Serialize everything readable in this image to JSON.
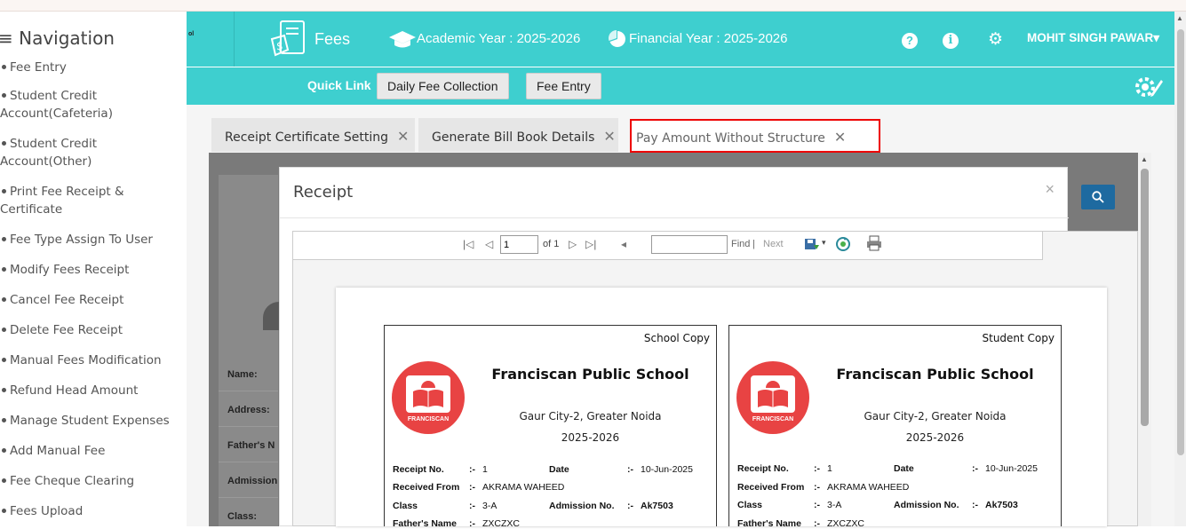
{
  "sidebar": {
    "title": "≡ Navigation",
    "items": [
      {
        "label": "Fee Entry"
      },
      {
        "label": "Student Credit Account(Cafeteria)"
      },
      {
        "label": "Student Credit Account(Other)"
      },
      {
        "label": "Print Fee Receipt & Certificate"
      },
      {
        "label": "Fee Type Assign To User"
      },
      {
        "label": "Modify Fees Receipt"
      },
      {
        "label": "Cancel Fee Receipt"
      },
      {
        "label": "Delete Fee Receipt"
      },
      {
        "label": "Manual Fees Modification"
      },
      {
        "label": "Refund Head Amount"
      },
      {
        "label": "Manage Student Expenses"
      },
      {
        "label": "Add Manual Fee"
      },
      {
        "label": "Fee Cheque Clearing"
      },
      {
        "label": "Fees Upload"
      }
    ]
  },
  "header": {
    "logo_text": "ol",
    "module": "Fees",
    "academic_year": "Academic Year : 2025-2026",
    "financial_year": "Financial Year : 2025-2026",
    "user": "MOHIT SINGH PAWAR",
    "user_caret": "▾"
  },
  "quicklink": {
    "label": "Quick Link",
    "buttons": [
      "Daily Fee Collection",
      "Fee Entry"
    ]
  },
  "tabs": [
    {
      "label": "Receipt Certificate Setting"
    },
    {
      "label": "Generate Bill Book Details"
    },
    {
      "label": "Pay Amount Without Structure"
    }
  ],
  "background_form": {
    "labels": [
      "Name:",
      "Address:",
      "Father's N",
      "Admission",
      "Class:"
    ]
  },
  "modal": {
    "title": "Receipt",
    "close": "×"
  },
  "viewer_toolbar": {
    "page_value": "1",
    "of_pages": "of 1",
    "find_value": "",
    "find_label": "Find",
    "separator": "|",
    "next_label": "Next"
  },
  "receipt": {
    "school_name": "Franciscan Public School",
    "address": "Gaur City-2, Greater Noida",
    "session": "2025-2026",
    "emblem_text": "FRANCISCAN",
    "copies": [
      {
        "label": "School Copy"
      },
      {
        "label": "Student Copy"
      }
    ],
    "fields": {
      "receipt_no_label": "Receipt No.",
      "receipt_no": "1",
      "date_label": "Date",
      "date": "10-Jun-2025",
      "received_from_label": "Received From",
      "received_from": "AKRAMA WAHEED",
      "class_label": "Class",
      "class": "3-A",
      "admission_label": "Admission No.",
      "admission": "Ak7503",
      "father_label": "Father's Name",
      "father": "ZXCZXC",
      "sep": ":-"
    }
  },
  "colors": {
    "header_teal": "#3ecfcf",
    "overlay_gray": "#7a7a7a",
    "emblem_red": "#e84343",
    "highlight_red": "#ee0000"
  }
}
